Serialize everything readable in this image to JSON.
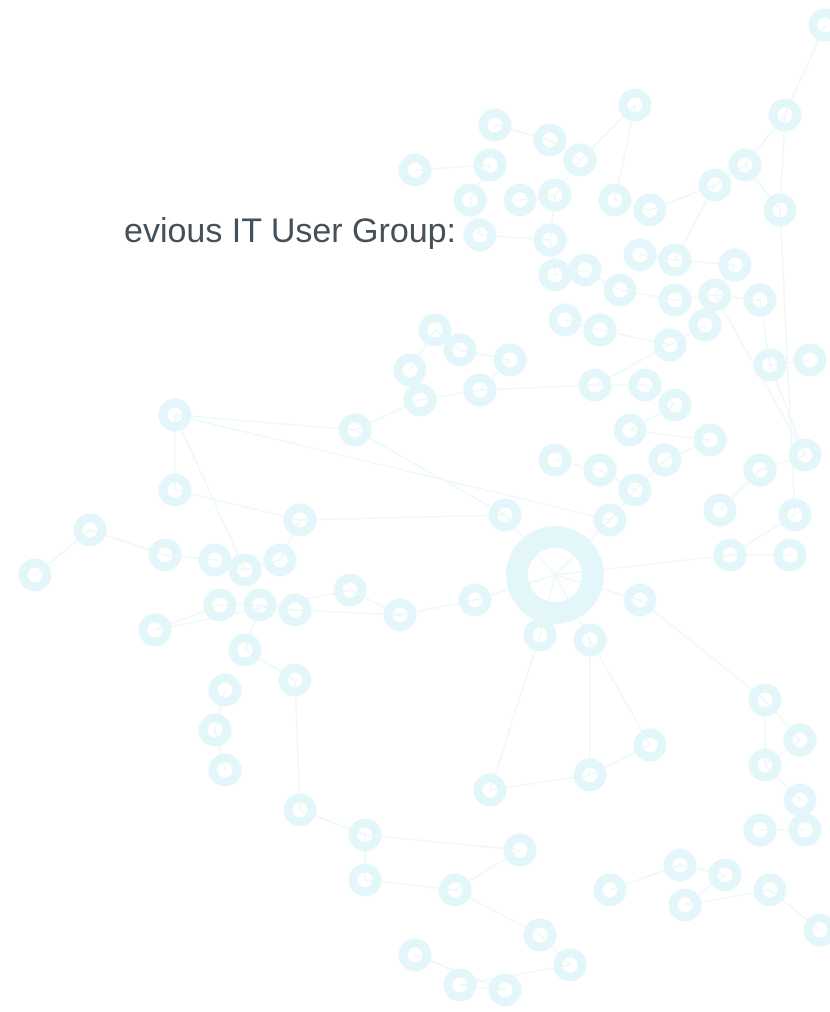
{
  "slide": {
    "heading": "evious IT User Group:"
  },
  "background": {
    "graphic": "network-nodes-graphic",
    "node_color": "#e3f6fa",
    "line_color": "#edf8fb"
  },
  "colors": {
    "text": "#44505a",
    "background": "#ffffff"
  }
}
